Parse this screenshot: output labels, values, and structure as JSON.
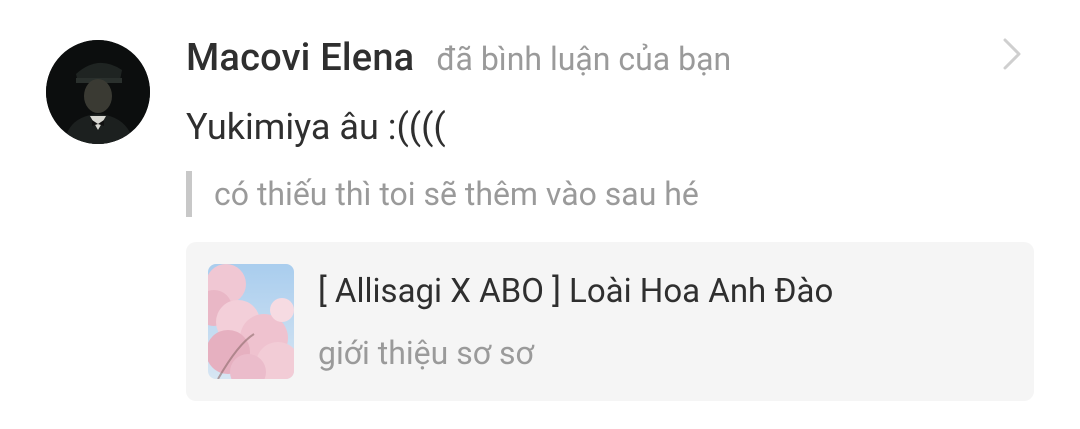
{
  "notification": {
    "user_name": "Macovi Elena",
    "action_text": "đã bình luận của bạn",
    "comment_text": "Yukimiya âu :((((",
    "quoted_text": "có thiếu thì toi sẽ thêm vào sau hé",
    "story": {
      "title": "[ Allisagi X ABO ] Loài Hoa Anh Đào",
      "description": "giới thiệu sơ sơ"
    },
    "icons": {
      "avatar": "user-avatar",
      "chevron": "chevron-right-icon",
      "cover": "story-cover-cherry-blossom"
    },
    "colors": {
      "primary_text": "#2f2f2f",
      "secondary_text": "#9a9a9a",
      "card_background": "#f5f5f5",
      "quote_bar": "#c8c8c8"
    }
  }
}
